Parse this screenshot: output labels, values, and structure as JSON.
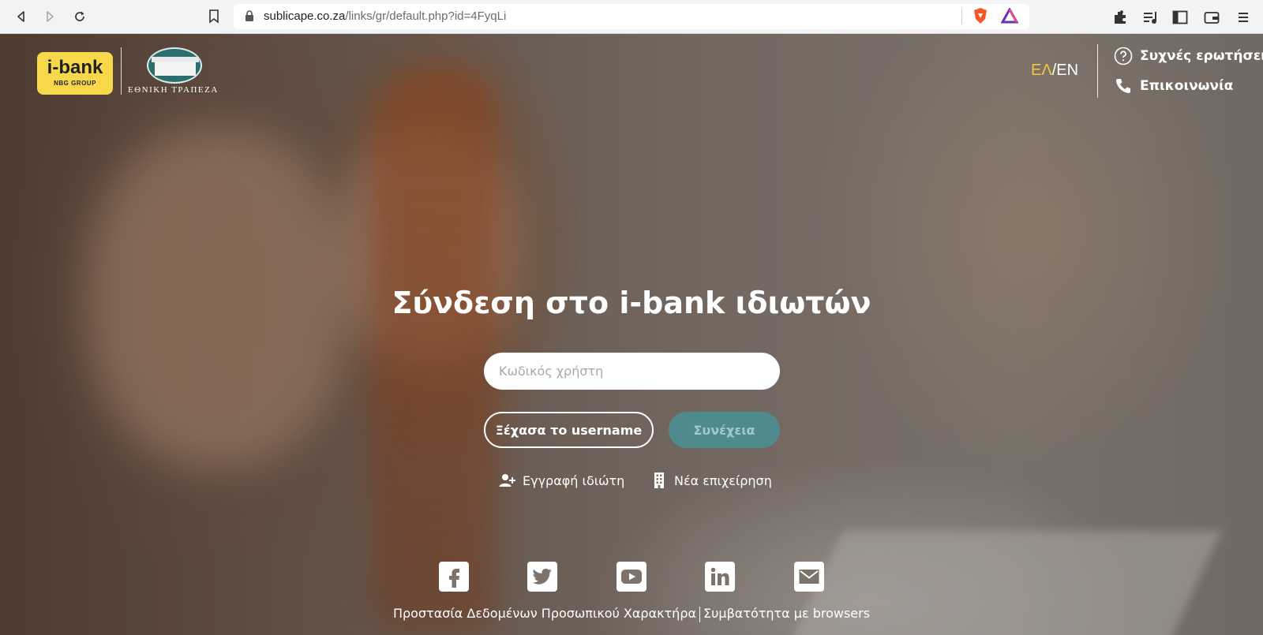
{
  "browser": {
    "url_host": "sublicape.co.za",
    "url_path": "/links/gr/default.php?id=4FyqLi"
  },
  "header": {
    "logo_primary": "i-bank",
    "logo_secondary": "NBG GROUP",
    "bank_name": "ΕΘΝΙΚΗ ΤΡΑΠΕΖΑ",
    "lang_el": "ΕΛ",
    "lang_sep": "/",
    "lang_en": "EN",
    "faq_label": "Συχνές ερωτήσεις",
    "contact_label": "Επικοινωνία"
  },
  "login": {
    "title": "Σύνδεση στο i-bank ιδιωτών",
    "username_placeholder": "Κωδικός χρήστη",
    "forgot_label": "Ξέχασα το username",
    "continue_label": "Συνέχεια",
    "register_label": "Εγγραφή ιδιώτη",
    "business_label": "Νέα επιχείρηση"
  },
  "social": [
    "facebook-icon",
    "twitter-icon",
    "youtube-icon",
    "linkedin-icon",
    "mail-icon"
  ],
  "footer": {
    "privacy_label": "Προστασία Δεδομένων Προσωπικού Χαρακτήρα",
    "browsers_label": "Συμβατότητα με browsers"
  },
  "colors": {
    "accent_yellow": "#f0c93e",
    "continue_button": "#4f8b8d",
    "logo_yellow": "#f6d84a"
  }
}
